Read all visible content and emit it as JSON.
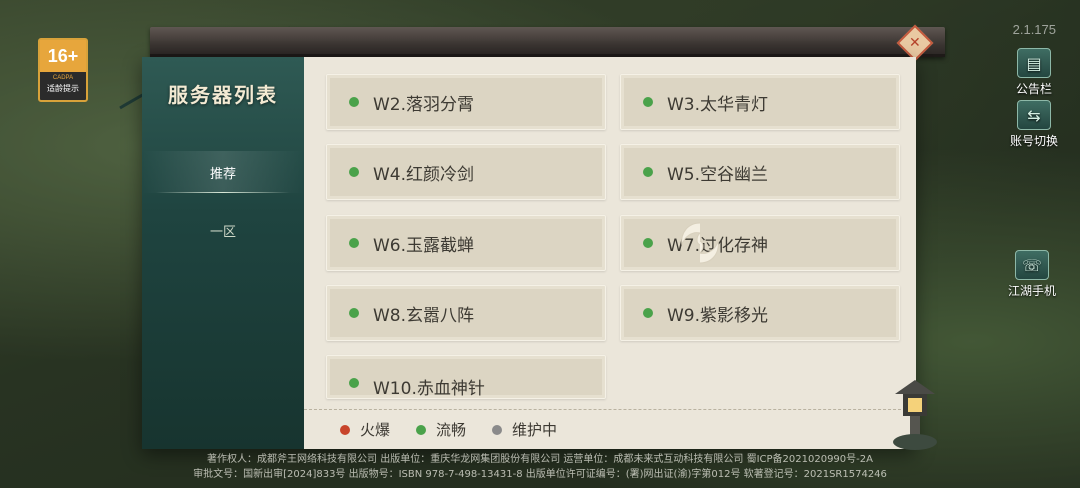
{
  "app": {
    "version": "2.1.175"
  },
  "age_rating": {
    "age": "16+",
    "org": "CADPA",
    "tip": "适龄提示"
  },
  "side_buttons": {
    "announcement": "公告栏",
    "switch_account": "账号切换",
    "phone": "江湖手机"
  },
  "panel": {
    "title": "服务器列表",
    "tabs": [
      {
        "label": "推荐",
        "active": true
      },
      {
        "label": "一区",
        "active": false
      }
    ]
  },
  "servers": [
    {
      "name": "W2.落羽分霄",
      "status": "流畅"
    },
    {
      "name": "W3.太华青灯",
      "status": "流畅"
    },
    {
      "name": "W4.红颜冷剑",
      "status": "流畅"
    },
    {
      "name": "W5.空谷幽兰",
      "status": "流畅"
    },
    {
      "name": "W6.玉露截蝉",
      "status": "流畅"
    },
    {
      "name": "W7.过化存神",
      "status": "流畅"
    },
    {
      "name": "W8.玄嚣八阵",
      "status": "流畅"
    },
    {
      "name": "W9.紫影移光",
      "status": "流畅"
    },
    {
      "name": "W10.赤血神针",
      "status": "流畅"
    }
  ],
  "legend": [
    {
      "label": "火爆",
      "color": "#c8442a"
    },
    {
      "label": "流畅",
      "color": "#4aa24a"
    },
    {
      "label": "维护中",
      "color": "#8a8a8a"
    }
  ],
  "colors": {
    "status_busy": "#c8442a",
    "status_smooth": "#4aa24a",
    "status_maintenance": "#8a8a8a"
  },
  "footer": {
    "line1": "著作权人：成都斧王网络科技有限公司 出版单位：重庆华龙网集团股份有限公司 运营单位：成都未来式互动科技有限公司 蜀ICP备2021020990号-2A",
    "line2": "审批文号：国新出审[2024]833号 出版物号：ISBN 978-7-498-13431-8 出版单位许可证编号：(署)网出证(渝)字第012号 软著登记号：2021SR1574246"
  }
}
